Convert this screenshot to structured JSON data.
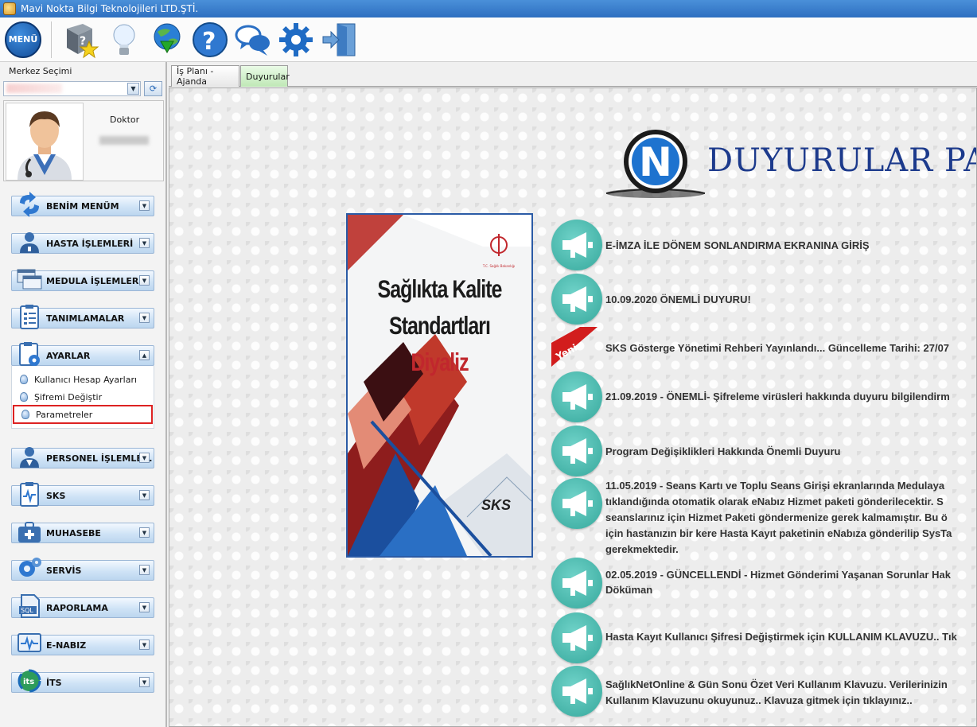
{
  "window": {
    "title": "Mavi Nokta Bilgi Teknolojileri LTD.ŞTİ."
  },
  "toolbar": {
    "menu_label": "MENÜ",
    "buttons": [
      "favorites-book-icon",
      "lightbulb-icon",
      "update-download-icon",
      "help-icon",
      "chat-icon",
      "settings-gear-icon",
      "exit-door-icon"
    ]
  },
  "sidebar": {
    "center_label": "Merkez Seçimi",
    "center_value": "",
    "profile_role": "Doktor",
    "menu": [
      {
        "label": "BENİM MENÜM",
        "icon": "refresh-arrows-icon"
      },
      {
        "label": "HASTA İŞLEMLERİ",
        "icon": "patient-icon"
      },
      {
        "label": "MEDULA İŞLEMLERİ",
        "icon": "windows-icon"
      },
      {
        "label": "TANIMLAMALAR",
        "icon": "clipboard-list-icon"
      },
      {
        "label": "AYARLAR",
        "icon": "settings-clipboard-icon",
        "expanded": true,
        "items": [
          "Kullanıcı Hesap Ayarları",
          "Şifremi Değiştir",
          "Parametreler"
        ]
      },
      {
        "label": "PERSONEL İŞLEMLE...",
        "icon": "staff-icon"
      },
      {
        "label": "SKS",
        "icon": "sks-clipboard-icon"
      },
      {
        "label": "MUHASEBE",
        "icon": "medical-bag-icon"
      },
      {
        "label": "SERVİS",
        "icon": "gears-icon"
      },
      {
        "label": "RAPORLAMA",
        "icon": "sql-report-icon"
      },
      {
        "label": "E-NABIZ",
        "icon": "pulse-monitor-icon"
      },
      {
        "label": "İTS",
        "icon": "its-logo-icon"
      }
    ]
  },
  "tabs": [
    {
      "label": "İş Planı - Ajanda",
      "active": false
    },
    {
      "label": "Duyurular",
      "active": true
    }
  ],
  "announcements": {
    "panel_title": "DUYURULAR PA",
    "book": {
      "title_line1": "Sağlıkta Kalite",
      "title_line2": "Standartları",
      "title_line3": "Diyaliz",
      "ministry": "T.C. Sağlık Bakanlığı",
      "sks": "SKS"
    },
    "yeni_label": "Yeni",
    "items": [
      {
        "lines": [
          "E-İMZA İLE DÖNEM SONLANDIRMA EKRANINA GİRİŞ"
        ],
        "new": false
      },
      {
        "lines": [
          "10.09.2020 ÖNEMLİ DUYURU!"
        ],
        "new": false
      },
      {
        "lines": [
          "SKS Gösterge Yönetimi Rehberi Yayınlandı... Güncelleme Tarihi: 27/07"
        ],
        "new": true
      },
      {
        "lines": [
          "21.09.2019 - ÖNEMLİ- Şifreleme virüsleri hakkında duyuru bilgilendirm"
        ],
        "new": false
      },
      {
        "lines": [
          "Program Değişiklikleri Hakkında Önemli Duyuru"
        ],
        "new": false
      },
      {
        "lines": [
          "11.05.2019 - Seans Kartı ve Toplu Seans Girişi ekranlarında Medulaya",
          "tıklandığında otomatik olarak eNabız Hizmet paketi gönderilecektir. S",
          "seanslarınız için Hizmet Paketi göndermenize gerek kalmamıştır. Bu ö",
          "için hastanızın bir kere Hasta Kayıt paketinin eNabıza gönderilip SysTa",
          "gerekmektedir."
        ],
        "new": false
      },
      {
        "lines": [
          "02.05.2019 - GÜNCELLENDİ - Hizmet Gönderimi Yaşanan Sorunlar Hak",
          "Döküman"
        ],
        "new": false
      },
      {
        "lines": [
          "Hasta Kayıt Kullanıcı Şifresi Değiştirmek için KULLANIM KLAVUZU.. Tık"
        ],
        "new": false
      },
      {
        "lines": [
          "SağlıkNetOnline & Gün Sonu Özet Veri Kullanım Klavuzu. Verilerinizin",
          "Kullanım Klavuzunu okuyunuz.. Klavuza gitmek için tıklayınız.."
        ],
        "new": false
      }
    ]
  }
}
